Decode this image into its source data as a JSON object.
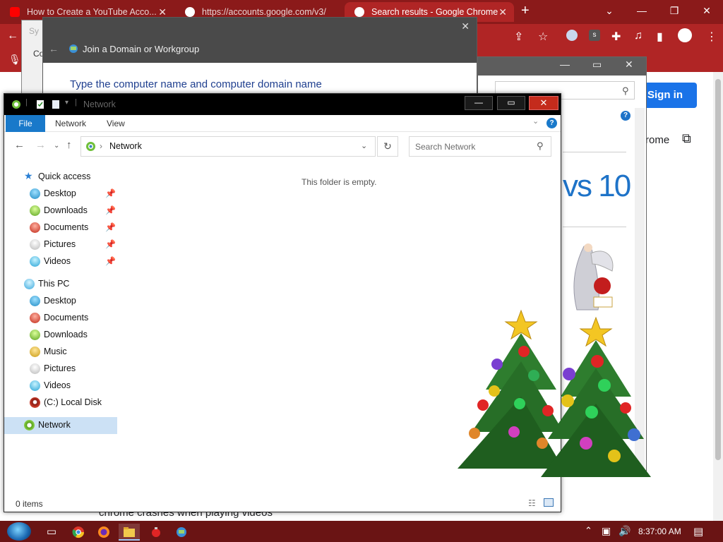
{
  "chrome": {
    "tabs": [
      {
        "title": "How to Create a YouTube Acco...",
        "favicon_color": "#ff0000",
        "active": false
      },
      {
        "title": "https://accounts.google.com/v3/",
        "favicon_color": "#ffffff",
        "active": false
      },
      {
        "title": "Search results - Google Chrome",
        "favicon_color": "#ffffff",
        "active": true
      }
    ],
    "new_tab_glyph": "+",
    "signin_label": "Sign in",
    "open_chrome_label": "rome",
    "bottom_link": "chrome crashes when playing videos",
    "extension_badge": "s"
  },
  "join_dialog": {
    "title": "Join a Domain or Workgroup",
    "heading": "Type the computer name and computer domain name",
    "side_letter": "Sy",
    "side_letter2": "Co"
  },
  "ie_window": {
    "win10_text": "vs 10",
    "help_glyph": "?"
  },
  "explorer": {
    "title": "Network",
    "ribbon_tabs": {
      "file": "File",
      "network": "Network",
      "view": "View"
    },
    "address": "Network",
    "search_placeholder": "Search Network",
    "empty_message": "This folder is empty.",
    "status": "0 items",
    "quick_access": {
      "label": "Quick access",
      "items": [
        "Desktop",
        "Downloads",
        "Documents",
        "Pictures",
        "Videos"
      ]
    },
    "this_pc": {
      "label": "This PC",
      "items": [
        "Desktop",
        "Documents",
        "Downloads",
        "Music",
        "Pictures",
        "Videos",
        "(C:) Local Disk"
      ]
    },
    "network_label": "Network"
  },
  "taskbar": {
    "time": "8:37:00 AM"
  },
  "colors": {
    "chrome_frame": "#b02525",
    "explorer_accent": "#1979ca",
    "close_button": "#c42b1c",
    "taskbar": "#6a1414"
  }
}
